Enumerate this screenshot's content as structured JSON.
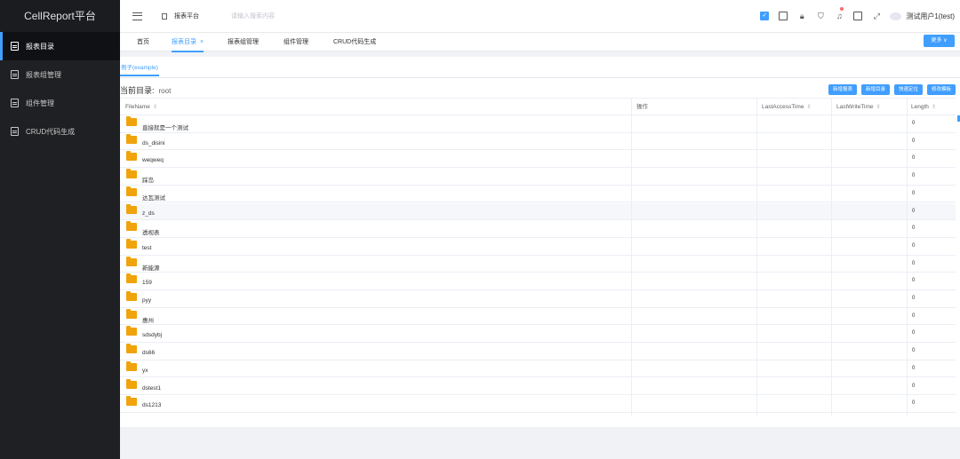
{
  "sidebar": {
    "brand": "CellReport平台",
    "items": [
      {
        "label": "报表目录"
      },
      {
        "label": "报表组管理"
      },
      {
        "label": "组件管理"
      },
      {
        "label": "CRUD代码生成"
      }
    ]
  },
  "header": {
    "crumb": "报表平台",
    "search_placeholder": "请输入搜索内容",
    "user": "测试用户1(test)"
  },
  "tabs": {
    "items": [
      {
        "label": "首页"
      },
      {
        "label": "报表目录",
        "close": "×"
      },
      {
        "label": "报表组管理"
      },
      {
        "label": "组件管理"
      },
      {
        "label": "CRUD代码生成"
      }
    ],
    "more_label": "更多 ∨"
  },
  "main": {
    "subtab": "例子(example)",
    "current_dir_label": "当前目录:",
    "current_dir_value": "root",
    "actions": [
      "新增报表",
      "新增目录",
      "快速定位",
      "修改模板"
    ],
    "columns": [
      "FileName",
      "操作",
      "LastAccessTime",
      "LastWriteTime",
      "Length"
    ],
    "sort_icon": "⇕",
    "rows": [
      {
        "name": "直接就是一个测试",
        "length": "0"
      },
      {
        "name": "ds_disini",
        "length": "0"
      },
      {
        "name": "weqweq",
        "length": "0"
      },
      {
        "name": "踩岛",
        "length": "0"
      },
      {
        "name": "达瓦测试",
        "length": "0"
      },
      {
        "name": "z_ds",
        "length": "0"
      },
      {
        "name": "透视表",
        "length": "0"
      },
      {
        "name": "test",
        "length": "0"
      },
      {
        "name": "新能源",
        "length": "0"
      },
      {
        "name": "159",
        "length": "0"
      },
      {
        "name": "pyy",
        "length": "0"
      },
      {
        "name": "惠州",
        "length": "0"
      },
      {
        "name": "sdsdybj",
        "length": "0"
      },
      {
        "name": "ds66",
        "length": "0"
      },
      {
        "name": "yx",
        "length": "0"
      },
      {
        "name": "dstest1",
        "length": "0"
      },
      {
        "name": "ds1213",
        "length": "0"
      }
    ]
  },
  "colors": {
    "accent": "#409eff",
    "sidebar": "#1f2023",
    "folder": "#f0a30a"
  }
}
